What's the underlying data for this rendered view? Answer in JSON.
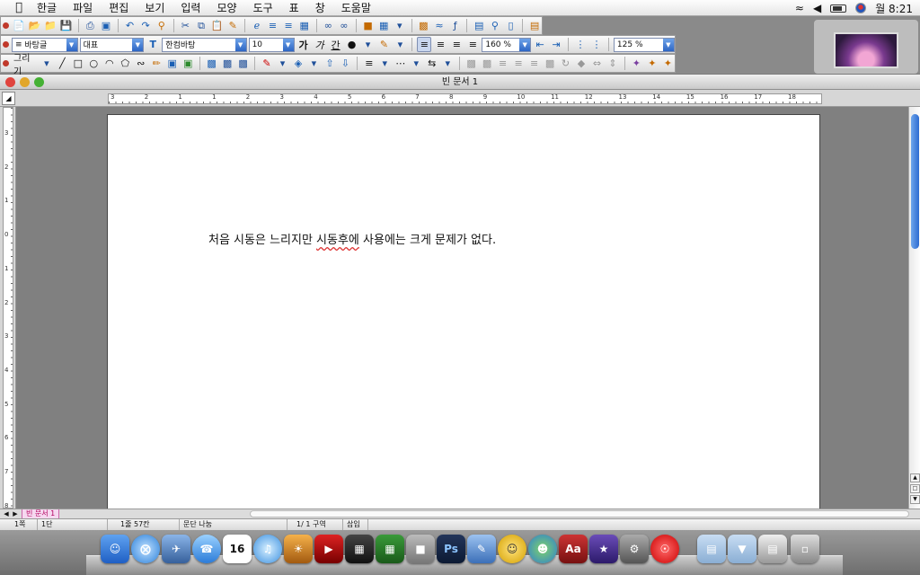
{
  "menubar": {
    "items": [
      "한글",
      "파일",
      "편집",
      "보기",
      "입력",
      "모양",
      "도구",
      "표",
      "창",
      "도움말"
    ],
    "clock": "월 8:21"
  },
  "toolbar": {
    "style_combo": "바탕글",
    "lang_combo": "대표",
    "font_combo": "한컴바탕",
    "size_combo": "10",
    "bold_glyph": "가",
    "italic_glyph": "가",
    "underline_glyph": "간",
    "linespacing_combo": "160 %",
    "zoom_combo": "125 %",
    "draw_label": "그리기"
  },
  "document": {
    "title": "빈 문서 1",
    "text_before": "처음 시동은 느리지만 ",
    "text_error": "시동후에",
    "text_after": " 사용에는 크게 문제가 없다."
  },
  "ruler": {
    "h_labels": [
      "3",
      "2",
      "1",
      "1",
      "2",
      "3",
      "4",
      "5",
      "6",
      "7",
      "8",
      "9",
      "10",
      "11",
      "12",
      "13",
      "14",
      "15",
      "16",
      "17",
      "18"
    ],
    "v_labels": [
      "3",
      "2",
      "1",
      "0",
      "1",
      "2",
      "3",
      "4",
      "5",
      "6",
      "7",
      "8"
    ]
  },
  "tabs": {
    "doc_tab": "빈 문서 1"
  },
  "status": {
    "page": "1쪽",
    "column": "1단",
    "line_col": "1줄  57칸",
    "para": "문단 나눔",
    "section": "1/  1 구역",
    "mode": "삽입"
  },
  "dock": {
    "photoshop": "Ps",
    "dictionary": "Aa",
    "calendar_day": "16"
  }
}
